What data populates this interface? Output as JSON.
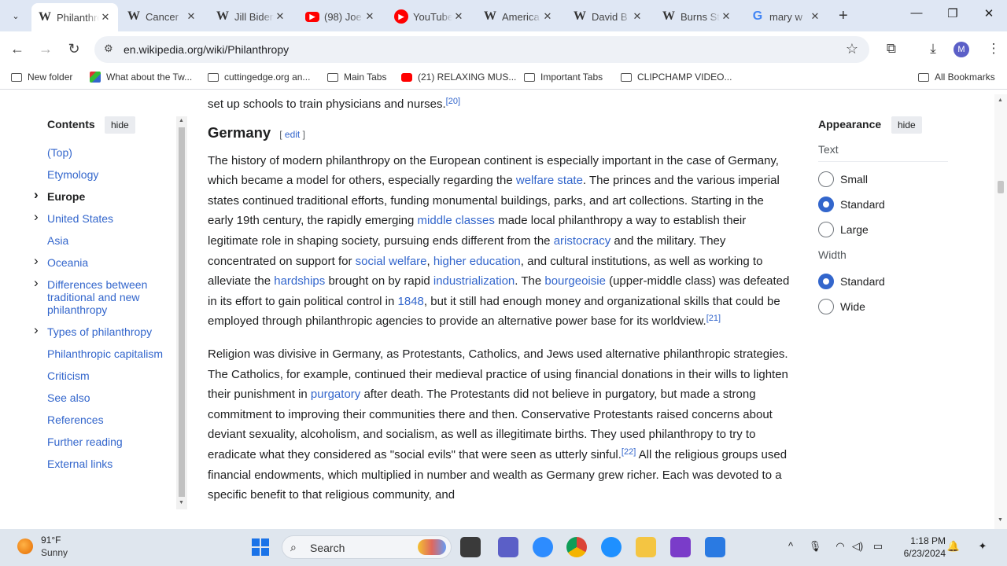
{
  "browser": {
    "tabs": [
      {
        "title": "Philanthropy",
        "favicon": "W",
        "active": true
      },
      {
        "title": "Cancer",
        "favicon": "W"
      },
      {
        "title": "Jill Biden",
        "favicon": "W"
      },
      {
        "title": "(98) Joe",
        "favicon": "yt"
      },
      {
        "title": "YouTube",
        "favicon": "yt2"
      },
      {
        "title": "America",
        "favicon": "W"
      },
      {
        "title": "David B",
        "favicon": "W"
      },
      {
        "title": "Burns St",
        "favicon": "W"
      },
      {
        "title": "mary w",
        "favicon": "G"
      }
    ],
    "url": "en.wikipedia.org/wiki/Philanthropy",
    "profile_initial": "M",
    "bookmarks": [
      "New folder",
      "What about the Tw...",
      "cuttingedge.org an...",
      "Main Tabs",
      "(21) RELAXING MUS...",
      "Important Tabs",
      "CLIPCHAMP VIDEO..."
    ],
    "all_bookmarks": "All Bookmarks"
  },
  "toc": {
    "title": "Contents",
    "hide": "hide",
    "items": [
      {
        "label": "(Top)"
      },
      {
        "label": "Etymology"
      },
      {
        "label": "Europe",
        "bold": true,
        "chevron": true
      },
      {
        "label": "United States",
        "chevron": true
      },
      {
        "label": "Asia"
      },
      {
        "label": "Oceania",
        "chevron": true
      },
      {
        "label": "Differences between traditional and new philanthropy",
        "chevron": true
      },
      {
        "label": "Types of philanthropy",
        "chevron": true
      },
      {
        "label": "Philanthropic capitalism"
      },
      {
        "label": "Criticism"
      },
      {
        "label": "See also"
      },
      {
        "label": "References"
      },
      {
        "label": "Further reading"
      },
      {
        "label": "External links"
      }
    ]
  },
  "article": {
    "intro_tail": "set up schools to train physicians and nurses.",
    "intro_ref": "[20]",
    "heading": "Germany",
    "edit_open": "[ ",
    "edit_label": "edit",
    "edit_close": " ]",
    "p1": [
      {
        "t": "The history of modern philanthropy on the European continent is especially important in the case of Germany, which became a model for others, especially regarding the "
      },
      {
        "t": "welfare state",
        "link": true
      },
      {
        "t": ". The princes and the various imperial states continued traditional efforts, funding monumental buildings, parks, and art collections. Starting in the early 19th century, the rapidly emerging "
      },
      {
        "t": "middle classes",
        "link": true
      },
      {
        "t": " made local philanthropy a way to establish their legitimate role in shaping society, pursuing ends different from the "
      },
      {
        "t": "aristocracy",
        "link": true
      },
      {
        "t": " and the military. They concentrated on support for "
      },
      {
        "t": "social welfare",
        "link": true
      },
      {
        "t": ", "
      },
      {
        "t": "higher education",
        "link": true
      },
      {
        "t": ", and cultural institutions, as well as working to alleviate the "
      },
      {
        "t": "hardships",
        "link": true
      },
      {
        "t": " brought on by rapid "
      },
      {
        "t": "industrialization",
        "link": true
      },
      {
        "t": ". The "
      },
      {
        "t": "bourgeoisie",
        "link": true
      },
      {
        "t": " (upper-middle class) was defeated in its effort to gain political control in "
      },
      {
        "t": "1848",
        "link": true
      },
      {
        "t": ", but it still had enough money and organizational skills that could be employed through philanthropic agencies to provide an alternative power base for its worldview."
      },
      {
        "t": "[21]",
        "ref": true
      }
    ],
    "p2": [
      {
        "t": "Religion was divisive in Germany, as Protestants, Catholics, and Jews used alternative philanthropic strategies. The Catholics, for example, continued their medieval practice of using financial donations in their wills to lighten their punishment in "
      },
      {
        "t": "purgatory",
        "link": true
      },
      {
        "t": " after death. The Protestants did not believe in purgatory, but made a strong commitment to improving their communities there and then. Conservative Protestants raised concerns about deviant sexuality, alcoholism, and socialism, as well as illegitimate births. They used philanthropy to try to eradicate what they considered as \"social evils\" that were seen as utterly sinful."
      },
      {
        "t": "[22]",
        "ref": true
      },
      {
        "t": " All the religious groups used financial endowments, which multiplied in number and wealth as Germany grew richer. Each was devoted to a specific benefit to that religious community, and"
      }
    ]
  },
  "appearance": {
    "title": "Appearance",
    "hide": "hide",
    "text_label": "Text",
    "text_options": [
      {
        "label": "Small",
        "checked": false
      },
      {
        "label": "Standard",
        "checked": true
      },
      {
        "label": "Large",
        "checked": false
      }
    ],
    "width_label": "Width",
    "width_options": [
      {
        "label": "Standard",
        "checked": true
      },
      {
        "label": "Wide",
        "checked": false
      }
    ]
  },
  "taskbar": {
    "temperature": "91°F",
    "weather": "Sunny",
    "search_label": "Search",
    "time": "1:18 PM",
    "date": "6/23/2024"
  },
  "colors": {
    "link": "#3366cc",
    "accent": "#3366cc",
    "chrome": "#dfe7f4"
  }
}
